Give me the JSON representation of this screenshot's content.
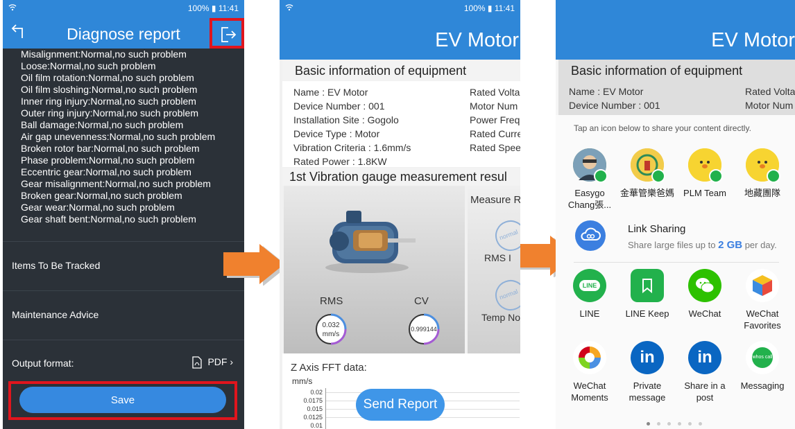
{
  "status": {
    "battery": "100%",
    "time": "11:41"
  },
  "panel1": {
    "title": "Diagnose report",
    "problems": [
      "Misalignment:Normal,no such problem",
      "Loose:Normal,no such problem",
      "Oil film rotation:Normal,no such problem",
      "Oil film sloshing:Normal,no such problem",
      "Inner ring injury:Normal,no such problem",
      "Outer ring injury:Normal,no such problem",
      "Ball damage:Normal,no such problem",
      "Air gap unevenness:Normal,no such problem",
      "Broken rotor bar:Normal,no such problem",
      "Phase problem:Normal,no such problem",
      "Eccentric gear:Normal,no such problem",
      "Gear misalignment:Normal,no such problem",
      "Broken gear:Normal,no such problem",
      "Gear wear:Normal,no such problem",
      "Gear shaft bent:Normal,no such problem"
    ],
    "items_tracked": "Items To Be Tracked",
    "maintenance": "Maintenance Advice",
    "output_format_label": "Output format:",
    "output_format_value": "PDF",
    "save": "Save"
  },
  "panel2": {
    "title": "EV Motor",
    "basic_title": "Basic information of equipment",
    "left_info": [
      "Name :  EV Motor",
      "Device Number :  001",
      "Installation Site :  Gogolo",
      "Device Type :  Motor",
      "Vibration Criteria :  1.6mm/s",
      "Rated Power :  1.8KW"
    ],
    "right_info": [
      "Rated Volta",
      "Motor Num",
      "Power Freq",
      "Rated Curre",
      "Rated Spee"
    ],
    "measure_title": "1st Vibration gauge measurement resul",
    "measure_r": "Measure R",
    "rms_label": "RMS",
    "rms_value": "0.032",
    "rms_unit": "mm/s",
    "cv_label": "CV",
    "cv_value": "0.999144",
    "stamp_text": "normal",
    "rms_side": "RMS I",
    "temp_side": "Temp No",
    "fft_title": "Z Axis FFT data:",
    "fft_unit": "mm/s",
    "fft_ticks": [
      "0.02",
      "0.0175",
      "0.015",
      "0.0125",
      "0.01"
    ],
    "send": "Send Report"
  },
  "panel3": {
    "title": "EV Motor",
    "basic_title": "Basic information of equipment",
    "left_info": [
      "Name :  EV Motor",
      "Device Number :  001"
    ],
    "right_info": [
      "Rated Volta",
      "Motor Num"
    ],
    "share_hint": "Tap an icon below to share your content directly.",
    "contacts": [
      "Easygo Chang張...",
      "金華管樂爸媽",
      "PLM Team",
      "地藏團隊"
    ],
    "link_sharing_title": "Link Sharing",
    "link_sharing_pre": "Share large files up to ",
    "link_sharing_gb": "2 GB",
    "link_sharing_post": " per day.",
    "apps_row1": [
      "LINE",
      "LINE Keep",
      "WeChat",
      "WeChat Favorites"
    ],
    "apps_row2": [
      "WeChat Moments",
      "Private message",
      "Share in a post",
      "Messaging"
    ],
    "line_icon_text": "LINE",
    "linkedin_text": "in",
    "whoscall_text": "whos call"
  },
  "colors": {
    "header_blue": "#2f87d8",
    "highlight_red": "#e0151d",
    "arrow_orange": "#f0812e",
    "dark_bg": "#2b3138",
    "line_green": "#22b14c",
    "wechat_green": "#2dc100",
    "linkedin_blue": "#0a66c2"
  }
}
